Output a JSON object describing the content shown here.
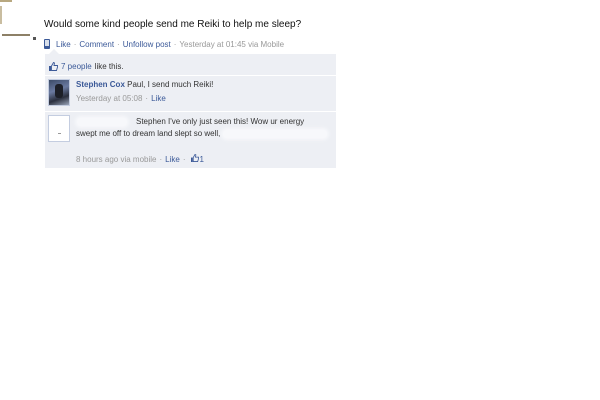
{
  "post": {
    "text": "Would some kind people send me Reiki to help me sleep?",
    "actions": {
      "like": "Like",
      "comment": "Comment",
      "unfollow": "Unfollow post",
      "timestamp": "Yesterday at 01:45 via Mobile"
    },
    "separator": "·"
  },
  "likes": {
    "count_text": "7 people",
    "suffix": "like this."
  },
  "comments": [
    {
      "author": "Stephen Cox",
      "text": "Paul, I send much Reiki!",
      "timestamp": "Yesterday at 05:08",
      "like_label": "Like",
      "avatar_icon": "user-photo"
    },
    {
      "author": "",
      "text_line1": "Stephen I've only just seen this! Wow ur energy",
      "text_line2": "swept me off to dream land slept so well,",
      "timestamp": "8 hours ago via mobile",
      "like_label": "Like",
      "like_count": "1",
      "avatar_icon": "blank-avatar"
    }
  ],
  "icons": {
    "mobile": "mobile-phone-icon",
    "thumb": "thumbs-up-icon"
  },
  "colors": {
    "link": "#3b5998",
    "meta": "#999999",
    "comment_bg": "#edeff4"
  }
}
